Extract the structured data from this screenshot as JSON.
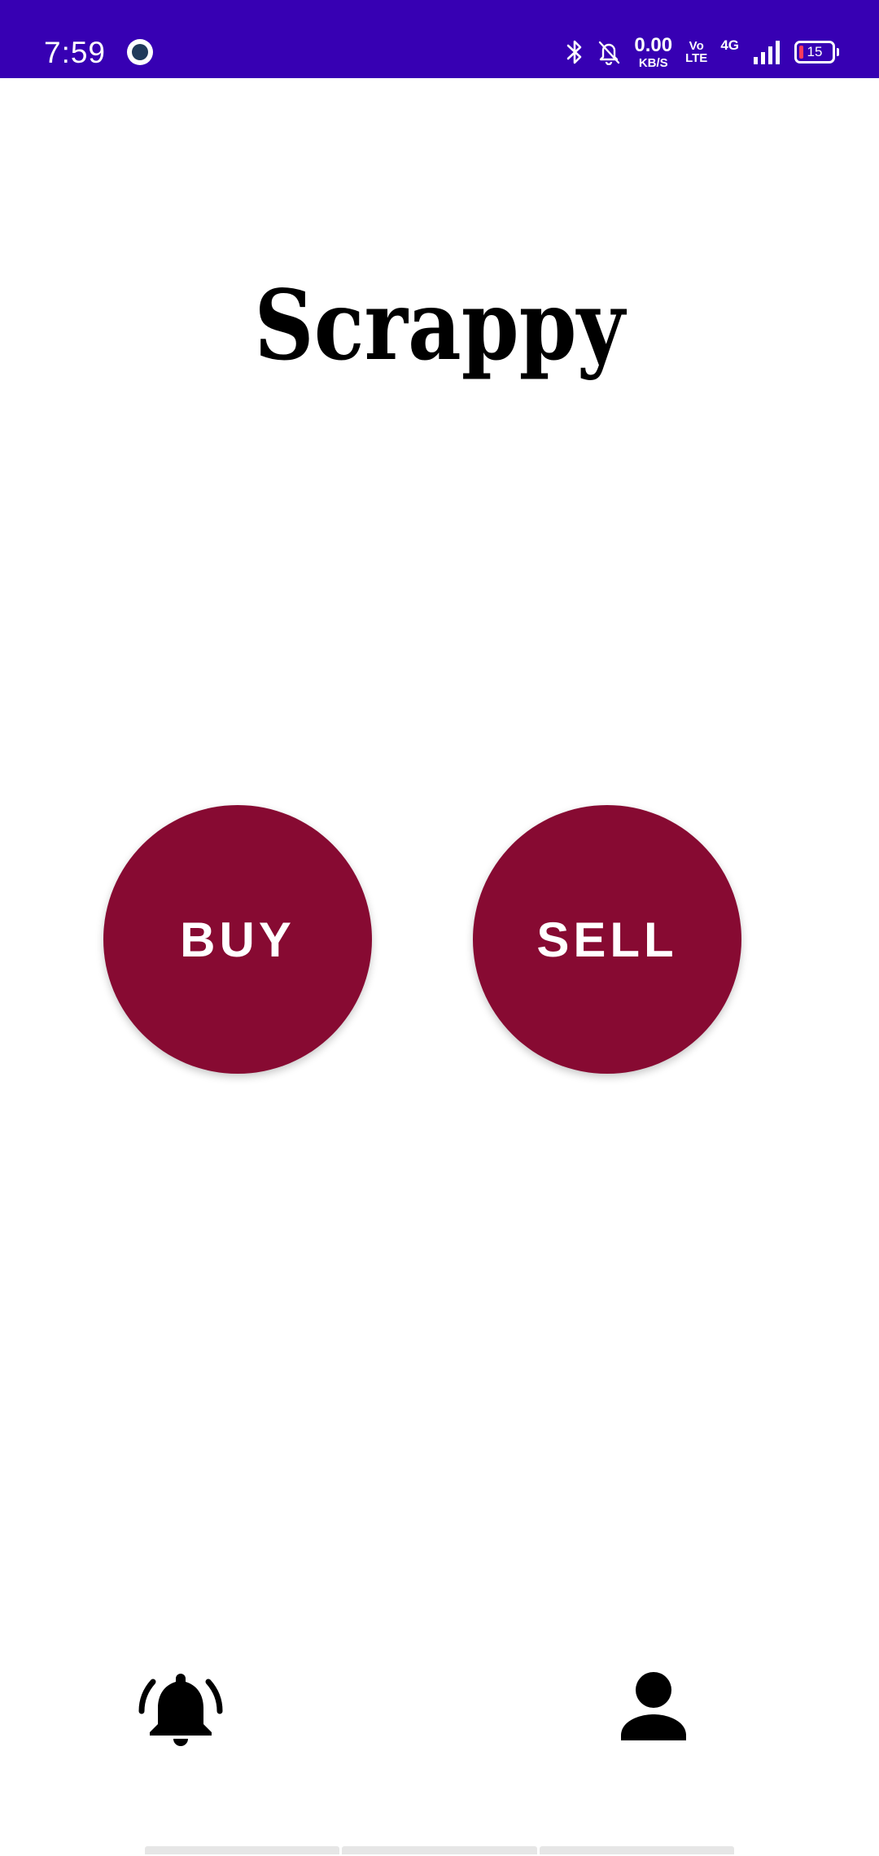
{
  "status_bar": {
    "time": "7:59",
    "net_speed_value": "0.00",
    "net_speed_unit": "KB/S",
    "volte_top": "Vo",
    "volte_bottom": "LTE",
    "network_type": "4G",
    "battery_level": "15",
    "background_color": "#3700b3",
    "icons": [
      "app-notification-icon",
      "bluetooth-icon",
      "notifications-off-icon",
      "signal-strength-icon",
      "battery-icon"
    ]
  },
  "main": {
    "title": "Scrappy",
    "buy_label": "BUY",
    "sell_label": "SELL",
    "button_color": "#870a32"
  },
  "bottom_nav": {
    "icons": [
      "notification-bell-icon",
      "profile-icon"
    ]
  }
}
